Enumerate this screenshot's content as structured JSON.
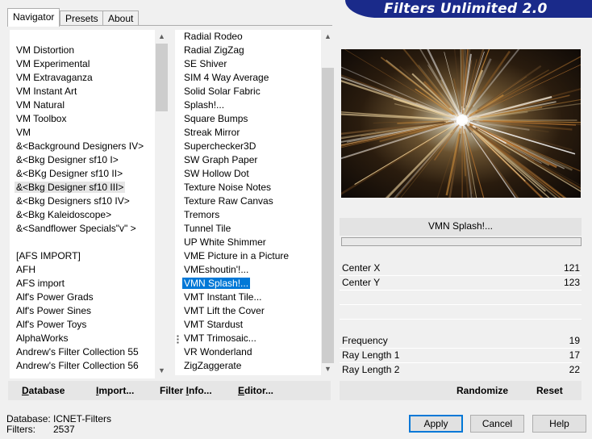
{
  "tabs": [
    "Navigator",
    "Presets",
    "About"
  ],
  "banner_title": "Filters Unlimited 2.0",
  "left_list": {
    "items": [
      "VM Distortion",
      "VM Experimental",
      "VM Extravaganza",
      "VM Instant Art",
      "VM Natural",
      "VM Toolbox",
      "VM",
      "&<Background Designers IV>",
      "&<Bkg Designer sf10 I>",
      "&<BKg Designer sf10 II>",
      "&<Bkg Designer sf10 III>",
      "&<Bkg Designers sf10 IV>",
      "&<Bkg Kaleidoscope>",
      "&<Sandflower Specials\"v\" >",
      "",
      "[AFS IMPORT]",
      "AFH",
      "AFS import",
      "Alf's Power Grads",
      "Alf's Power Sines",
      "Alf's Power Toys",
      "AlphaWorks",
      "Andrew's Filter Collection 55",
      "Andrew's Filter Collection 56"
    ],
    "highlighted_index": 10
  },
  "right_list": {
    "items": [
      "Radial Rodeo",
      "Radial ZigZag",
      "SE Shiver",
      "SIM 4 Way Average",
      "Solid Solar Fabric",
      "Splash!...",
      "Square Bumps",
      "Streak Mirror",
      "Superchecker3D",
      "SW Graph Paper",
      "SW Hollow Dot",
      "Texture Noise Notes",
      "Texture Raw Canvas",
      "Tremors",
      "Tunnel Tile",
      "UP White Shimmer",
      "VME Picture in a Picture",
      "VMEshoutin'!...",
      "VMN Splash!...",
      "VMT Instant Tile...",
      "VMT Lift the Cover",
      "VMT Stardust",
      "VMT Trimosaic...",
      "VR Wonderland",
      "ZigZaggerate"
    ],
    "selected_index": 18
  },
  "filter_title": "VMN Splash!...",
  "params": [
    {
      "label": "Center X",
      "value": "121"
    },
    {
      "label": "Center Y",
      "value": "123"
    },
    {
      "label": "Frequency",
      "value": "19"
    },
    {
      "label": "Ray Length 1",
      "value": "17"
    },
    {
      "label": "Ray Length 2",
      "value": "22"
    }
  ],
  "toolbar": {
    "database": {
      "u": "D",
      "rest": "atabase"
    },
    "import": {
      "u": "I",
      "rest": "mport..."
    },
    "filter_info": {
      "pre": "Filter ",
      "u": "I",
      "rest": "nfo..."
    },
    "editor": {
      "u": "E",
      "rest": "ditor..."
    },
    "randomize": "Randomize",
    "reset": "Reset"
  },
  "status": {
    "database_label": "Database:",
    "database_value": "ICNET-Filters",
    "filters_label": "Filters:",
    "filters_value": "2537"
  },
  "buttons": {
    "apply": "Apply",
    "cancel": "Cancel",
    "help": "Help"
  }
}
